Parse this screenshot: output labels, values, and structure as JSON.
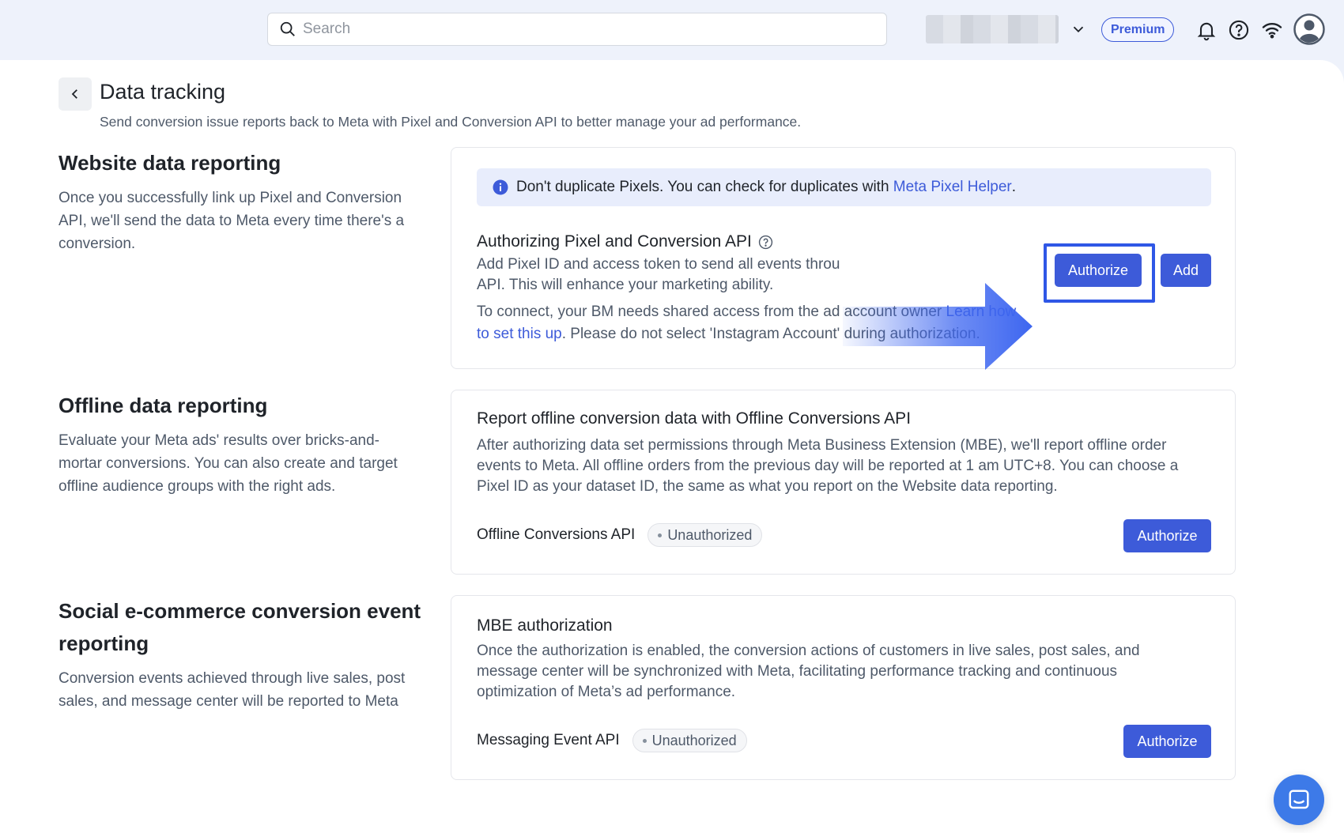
{
  "topbar": {
    "search_placeholder": "Search",
    "premium_label": "Premium"
  },
  "page": {
    "title": "Data tracking",
    "subtitle": "Send conversion issue reports back to Meta with Pixel and Conversion API to better manage your ad performance."
  },
  "sections": {
    "website": {
      "title": "Website data reporting",
      "description": "Once you successfully link up Pixel and Conversion API, we'll send the data to Meta every time there's a conversion."
    },
    "offline": {
      "title": "Offline data reporting",
      "description": "Evaluate your Meta ads' results over bricks-and-mortar conversions. You can also create and target offline audience groups with the right ads."
    },
    "social": {
      "title": "Social e-commerce conversion event reporting",
      "description": "Conversion events achieved through live sales, post sales, and message center will be reported to Meta"
    }
  },
  "website_card": {
    "banner_text": "Don't duplicate Pixels. You can check for duplicates with ",
    "banner_link": "Meta Pixel Helper",
    "banner_end": ".",
    "title": "Authorizing Pixel and Conversion API",
    "text_line1": "Add Pixel ID and access token to send all events throu",
    "text_line2": "API. This will enhance your marketing ability.",
    "connect_text": "To connect, your BM needs shared access from the ad account owner ",
    "connect_link_a": "Learn how",
    "connect_link_b": "to set this up",
    "connect_end": ". Please do not select 'Instagram Account' during authorization.",
    "authorize_label": "Authorize",
    "add_label": "Add"
  },
  "offline_card": {
    "title": "Report offline conversion data with Offline Conversions API",
    "text": [
      "After authorizing data set permissions through Meta Business Extension (MBE), we'll report offline order",
      "events to Meta. All offline orders from the previous day will be reported at 1 am UTC+8. You can choose a",
      "Pixel ID as your dataset ID, the same as what you report on the Website data reporting."
    ],
    "api_name": "Offline Conversions API",
    "status": "Unauthorized",
    "authorize_label": "Authorize"
  },
  "mbe_card": {
    "title": "MBE authorization",
    "text": [
      "Once the authorization is enabled, the conversion actions of customers in live sales, post sales, and",
      "message center will be synchronized with Meta, facilitating performance tracking and continuous",
      "optimization of Meta’s ad performance."
    ],
    "api_name": "Messaging Event API",
    "status": "Unauthorized",
    "authorize_label": "Authorize"
  },
  "colors": {
    "primary": "#3d5bd9",
    "highlight": "#2f57e6",
    "page_bg": "#eef2fb"
  }
}
